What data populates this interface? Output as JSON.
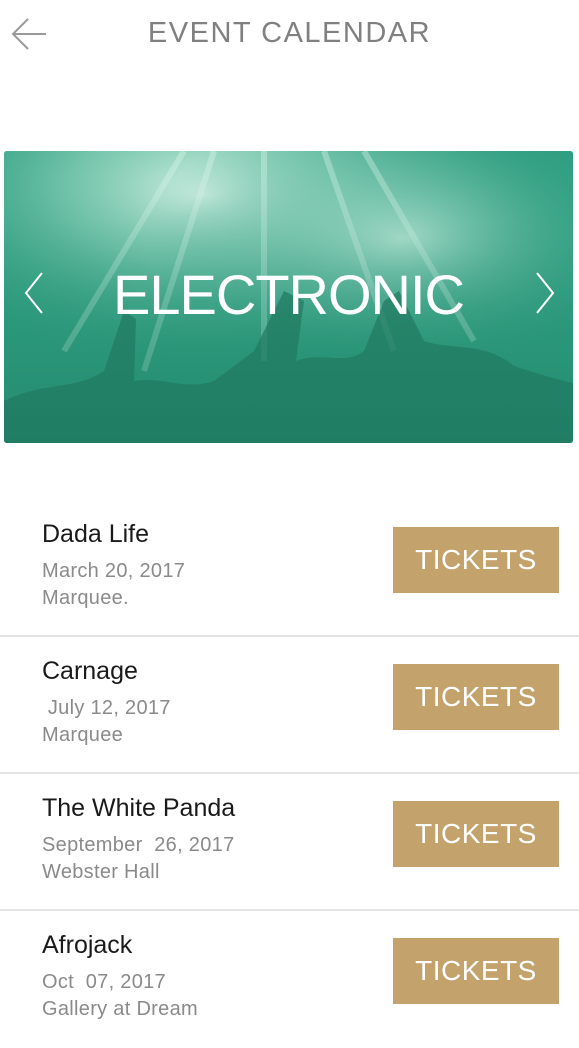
{
  "header": {
    "title": "EVENT CALENDAR",
    "back_icon": "arrow-left-icon"
  },
  "banner": {
    "title": "ELECTRONIC",
    "prev_icon": "chevron-left-icon",
    "next_icon": "chevron-right-icon",
    "tint_color": "#2e9e80"
  },
  "events": [
    {
      "name": "Dada Life",
      "date": "March 20, 2017",
      "venue": "Marquee.",
      "button": "TICKETS"
    },
    {
      "name": "Carnage",
      "date": " July 12, 2017",
      "venue": "Marquee",
      "button": "TICKETS"
    },
    {
      "name": "The White Panda",
      "date": "September  26, 2017",
      "venue": "Webster Hall",
      "button": "TICKETS"
    },
    {
      "name": "Afrojack",
      "date": "Oct  07, 2017",
      "venue": "Gallery at Dream",
      "button": "TICKETS"
    }
  ],
  "colors": {
    "accent": "#c4a26c",
    "title_gray": "#808080",
    "divider": "#e3e3e3"
  }
}
